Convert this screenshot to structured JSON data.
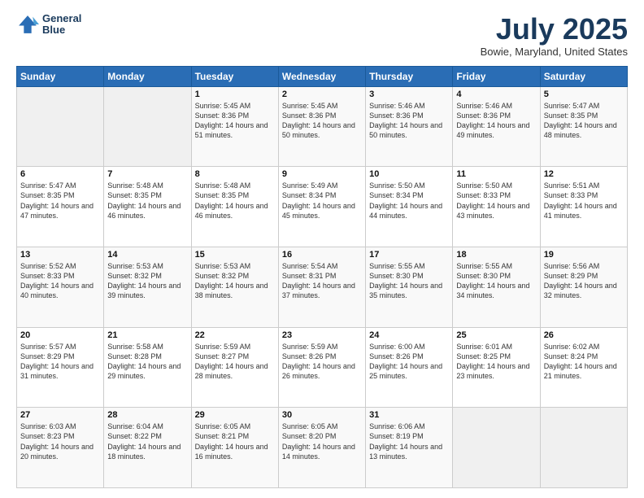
{
  "header": {
    "logo_line1": "General",
    "logo_line2": "Blue",
    "month": "July 2025",
    "location": "Bowie, Maryland, United States"
  },
  "weekdays": [
    "Sunday",
    "Monday",
    "Tuesday",
    "Wednesday",
    "Thursday",
    "Friday",
    "Saturday"
  ],
  "weeks": [
    [
      {
        "day": "",
        "sunrise": "",
        "sunset": "",
        "daylight": ""
      },
      {
        "day": "",
        "sunrise": "",
        "sunset": "",
        "daylight": ""
      },
      {
        "day": "1",
        "sunrise": "Sunrise: 5:45 AM",
        "sunset": "Sunset: 8:36 PM",
        "daylight": "Daylight: 14 hours and 51 minutes."
      },
      {
        "day": "2",
        "sunrise": "Sunrise: 5:45 AM",
        "sunset": "Sunset: 8:36 PM",
        "daylight": "Daylight: 14 hours and 50 minutes."
      },
      {
        "day": "3",
        "sunrise": "Sunrise: 5:46 AM",
        "sunset": "Sunset: 8:36 PM",
        "daylight": "Daylight: 14 hours and 50 minutes."
      },
      {
        "day": "4",
        "sunrise": "Sunrise: 5:46 AM",
        "sunset": "Sunset: 8:36 PM",
        "daylight": "Daylight: 14 hours and 49 minutes."
      },
      {
        "day": "5",
        "sunrise": "Sunrise: 5:47 AM",
        "sunset": "Sunset: 8:35 PM",
        "daylight": "Daylight: 14 hours and 48 minutes."
      }
    ],
    [
      {
        "day": "6",
        "sunrise": "Sunrise: 5:47 AM",
        "sunset": "Sunset: 8:35 PM",
        "daylight": "Daylight: 14 hours and 47 minutes."
      },
      {
        "day": "7",
        "sunrise": "Sunrise: 5:48 AM",
        "sunset": "Sunset: 8:35 PM",
        "daylight": "Daylight: 14 hours and 46 minutes."
      },
      {
        "day": "8",
        "sunrise": "Sunrise: 5:48 AM",
        "sunset": "Sunset: 8:35 PM",
        "daylight": "Daylight: 14 hours and 46 minutes."
      },
      {
        "day": "9",
        "sunrise": "Sunrise: 5:49 AM",
        "sunset": "Sunset: 8:34 PM",
        "daylight": "Daylight: 14 hours and 45 minutes."
      },
      {
        "day": "10",
        "sunrise": "Sunrise: 5:50 AM",
        "sunset": "Sunset: 8:34 PM",
        "daylight": "Daylight: 14 hours and 44 minutes."
      },
      {
        "day": "11",
        "sunrise": "Sunrise: 5:50 AM",
        "sunset": "Sunset: 8:33 PM",
        "daylight": "Daylight: 14 hours and 43 minutes."
      },
      {
        "day": "12",
        "sunrise": "Sunrise: 5:51 AM",
        "sunset": "Sunset: 8:33 PM",
        "daylight": "Daylight: 14 hours and 41 minutes."
      }
    ],
    [
      {
        "day": "13",
        "sunrise": "Sunrise: 5:52 AM",
        "sunset": "Sunset: 8:33 PM",
        "daylight": "Daylight: 14 hours and 40 minutes."
      },
      {
        "day": "14",
        "sunrise": "Sunrise: 5:53 AM",
        "sunset": "Sunset: 8:32 PM",
        "daylight": "Daylight: 14 hours and 39 minutes."
      },
      {
        "day": "15",
        "sunrise": "Sunrise: 5:53 AM",
        "sunset": "Sunset: 8:32 PM",
        "daylight": "Daylight: 14 hours and 38 minutes."
      },
      {
        "day": "16",
        "sunrise": "Sunrise: 5:54 AM",
        "sunset": "Sunset: 8:31 PM",
        "daylight": "Daylight: 14 hours and 37 minutes."
      },
      {
        "day": "17",
        "sunrise": "Sunrise: 5:55 AM",
        "sunset": "Sunset: 8:30 PM",
        "daylight": "Daylight: 14 hours and 35 minutes."
      },
      {
        "day": "18",
        "sunrise": "Sunrise: 5:55 AM",
        "sunset": "Sunset: 8:30 PM",
        "daylight": "Daylight: 14 hours and 34 minutes."
      },
      {
        "day": "19",
        "sunrise": "Sunrise: 5:56 AM",
        "sunset": "Sunset: 8:29 PM",
        "daylight": "Daylight: 14 hours and 32 minutes."
      }
    ],
    [
      {
        "day": "20",
        "sunrise": "Sunrise: 5:57 AM",
        "sunset": "Sunset: 8:29 PM",
        "daylight": "Daylight: 14 hours and 31 minutes."
      },
      {
        "day": "21",
        "sunrise": "Sunrise: 5:58 AM",
        "sunset": "Sunset: 8:28 PM",
        "daylight": "Daylight: 14 hours and 29 minutes."
      },
      {
        "day": "22",
        "sunrise": "Sunrise: 5:59 AM",
        "sunset": "Sunset: 8:27 PM",
        "daylight": "Daylight: 14 hours and 28 minutes."
      },
      {
        "day": "23",
        "sunrise": "Sunrise: 5:59 AM",
        "sunset": "Sunset: 8:26 PM",
        "daylight": "Daylight: 14 hours and 26 minutes."
      },
      {
        "day": "24",
        "sunrise": "Sunrise: 6:00 AM",
        "sunset": "Sunset: 8:26 PM",
        "daylight": "Daylight: 14 hours and 25 minutes."
      },
      {
        "day": "25",
        "sunrise": "Sunrise: 6:01 AM",
        "sunset": "Sunset: 8:25 PM",
        "daylight": "Daylight: 14 hours and 23 minutes."
      },
      {
        "day": "26",
        "sunrise": "Sunrise: 6:02 AM",
        "sunset": "Sunset: 8:24 PM",
        "daylight": "Daylight: 14 hours and 21 minutes."
      }
    ],
    [
      {
        "day": "27",
        "sunrise": "Sunrise: 6:03 AM",
        "sunset": "Sunset: 8:23 PM",
        "daylight": "Daylight: 14 hours and 20 minutes."
      },
      {
        "day": "28",
        "sunrise": "Sunrise: 6:04 AM",
        "sunset": "Sunset: 8:22 PM",
        "daylight": "Daylight: 14 hours and 18 minutes."
      },
      {
        "day": "29",
        "sunrise": "Sunrise: 6:05 AM",
        "sunset": "Sunset: 8:21 PM",
        "daylight": "Daylight: 14 hours and 16 minutes."
      },
      {
        "day": "30",
        "sunrise": "Sunrise: 6:05 AM",
        "sunset": "Sunset: 8:20 PM",
        "daylight": "Daylight: 14 hours and 14 minutes."
      },
      {
        "day": "31",
        "sunrise": "Sunrise: 6:06 AM",
        "sunset": "Sunset: 8:19 PM",
        "daylight": "Daylight: 14 hours and 13 minutes."
      },
      {
        "day": "",
        "sunrise": "",
        "sunset": "",
        "daylight": ""
      },
      {
        "day": "",
        "sunrise": "",
        "sunset": "",
        "daylight": ""
      }
    ]
  ]
}
